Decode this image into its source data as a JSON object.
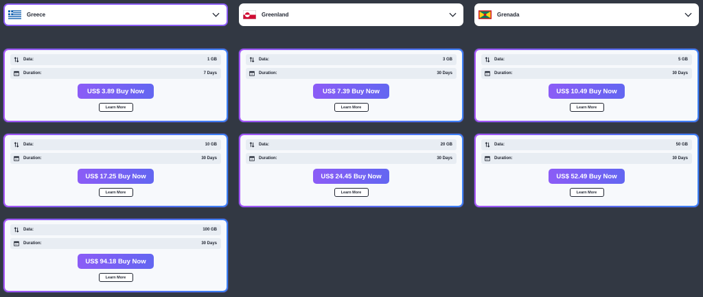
{
  "countries": [
    {
      "name": "Greece",
      "flag": "greece-flag",
      "selected": true
    },
    {
      "name": "Greenland",
      "flag": "greenland-flag",
      "selected": false
    },
    {
      "name": "Grenada",
      "flag": "grenada-flag",
      "selected": false
    }
  ],
  "labels": {
    "data": "Data:",
    "duration": "Duration:",
    "learn_more": "Learn More"
  },
  "plans": [
    {
      "data": "1 GB",
      "duration": "7 Days",
      "buy": "US$ 3.89 Buy Now"
    },
    {
      "data": "3 GB",
      "duration": "30 Days",
      "buy": "US$ 7.39 Buy Now"
    },
    {
      "data": "5 GB",
      "duration": "30 Days",
      "buy": "US$ 10.49 Buy Now"
    },
    {
      "data": "10 GB",
      "duration": "30 Days",
      "buy": "US$ 17.25 Buy Now"
    },
    {
      "data": "20 GB",
      "duration": "30 Days",
      "buy": "US$ 24.45 Buy Now"
    },
    {
      "data": "50 GB",
      "duration": "30 Days",
      "buy": "US$ 52.49 Buy Now"
    },
    {
      "data": "100 GB",
      "duration": "30 Days",
      "buy": "US$ 94.18 Buy Now"
    }
  ],
  "colors": {
    "background": "#323843",
    "accent_start": "#8b5cf6",
    "accent_end": "#6366f1"
  }
}
